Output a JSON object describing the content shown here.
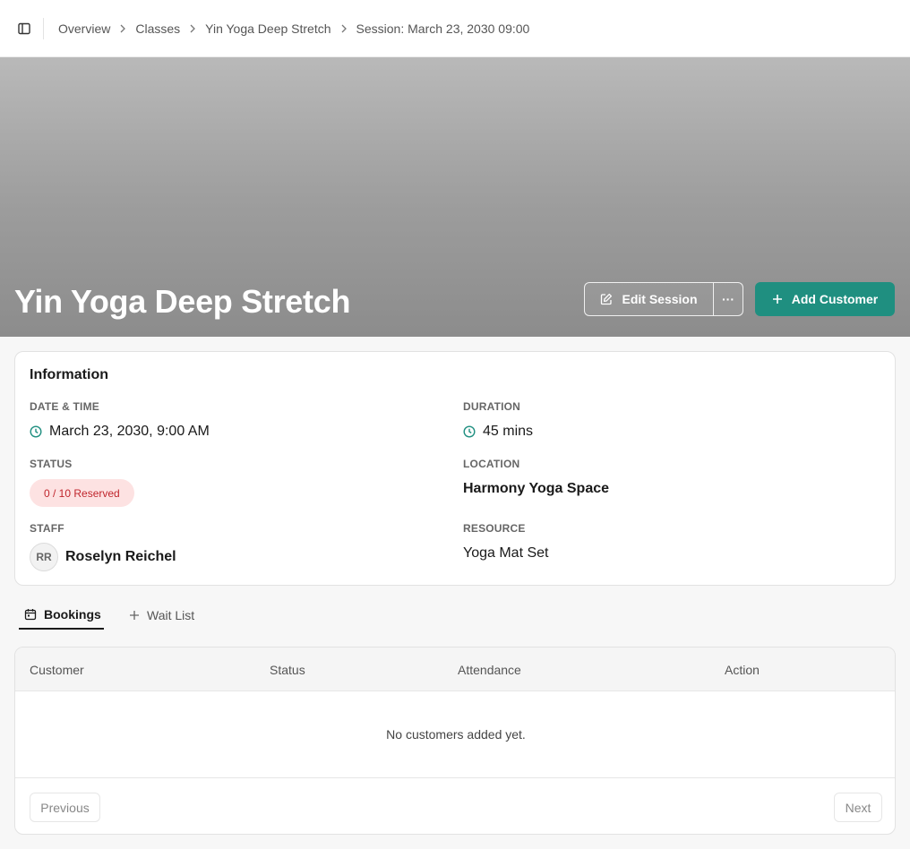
{
  "breadcrumb": {
    "items": [
      "Overview",
      "Classes",
      "Yin Yoga Deep Stretch",
      "Session: March 23, 2030 09:00"
    ]
  },
  "hero": {
    "title": "Yin Yoga Deep Stretch",
    "edit_label": "Edit Session",
    "more_label": "···",
    "add_label": "Add Customer"
  },
  "info": {
    "title": "Information",
    "date_label": "DATE & TIME",
    "date_value": "March 23, 2030, 9:00 AM",
    "duration_label": "DURATION",
    "duration_value": "45 mins",
    "status_label": "STATUS",
    "status_value": "0 / 10 Reserved",
    "location_label": "LOCATION",
    "location_value": "Harmony Yoga Space",
    "staff_label": "STAFF",
    "staff_initials": "RR",
    "staff_name": "Roselyn Reichel",
    "resource_label": "RESOURCE",
    "resource_value": "Yoga Mat Set"
  },
  "tabs": {
    "bookings": "Bookings",
    "waitlist": "Wait List"
  },
  "table": {
    "columns": [
      "Customer",
      "Status",
      "Attendance",
      "Action"
    ],
    "empty": "No customers added yet.",
    "prev": "Previous",
    "next": "Next"
  },
  "colors": {
    "accent": "#1f8f80",
    "badge_bg": "#fde2e2",
    "badge_text": "#c0262d"
  },
  "icons": {
    "sidebar": "sidebar-toggle-icon",
    "edit": "pencil-icon",
    "add": "plus-icon",
    "clock": "clock-icon",
    "calendar": "calendar-icon"
  }
}
